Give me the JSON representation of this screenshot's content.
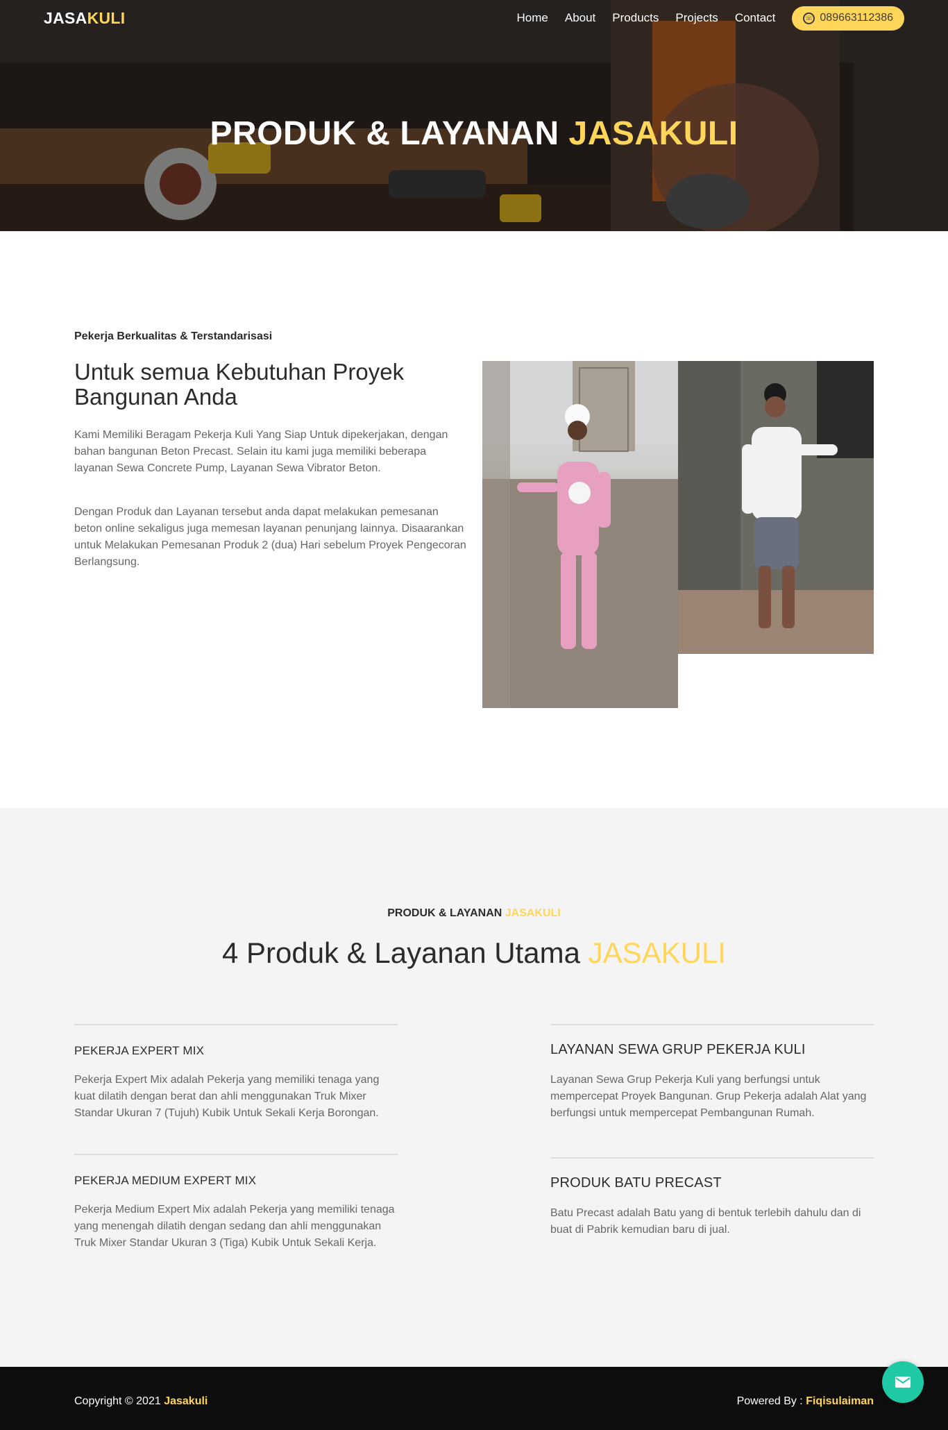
{
  "brand": {
    "part1": "JASA",
    "part2": "KULI"
  },
  "nav": {
    "items": [
      "Home",
      "About",
      "Products",
      "Projects",
      "Contact"
    ],
    "phone": "089663112386"
  },
  "hero": {
    "title_main": "PRODUK & LAYANAN",
    "title_accent": "JASAKULI"
  },
  "about": {
    "eyebrow": "Pekerja Berkualitas & Terstandarisasi",
    "heading": "Untuk semua Kebutuhan Proyek Bangunan Anda",
    "paragraph1": "Kami Memiliki Beragam Pekerja Kuli Yang Siap Untuk dipekerjakan, dengan bahan bangunan Beton Precast. Selain itu kami juga memiliki beberapa layanan Sewa Concrete Pump, Layanan Sewa Vibrator Beton.",
    "paragraph2": "Dengan Produk dan Layanan tersebut anda dapat melakukan pemesanan beton online sekaligus juga memesan layanan penunjang lainnya. Disaarankan untuk Melakukan Pemesanan Produk 2 (dua) Hari sebelum Proyek Pengecoran Berlangsung."
  },
  "services": {
    "eyebrow_main": "PRODUK & LAYANAN",
    "eyebrow_accent": "JASAKULI",
    "heading_main": "4 Produk & Layanan Utama",
    "heading_accent": "JASAKULI",
    "items": [
      {
        "title": "PEKERJA EXPERT MIX",
        "text": "Pekerja Expert Mix adalah Pekerja yang memiliki tenaga yang kuat dilatih dengan berat dan ahli menggunakan Truk Mixer Standar Ukuran 7 (Tujuh) Kubik Untuk Sekali Kerja Borongan."
      },
      {
        "title": "PEKERJA MEDIUM EXPERT MIX",
        "text": "Pekerja Medium Expert Mix adalah Pekerja yang memiliki tenaga yang menengah dilatih dengan sedang dan ahli menggunakan Truk Mixer Standar Ukuran 3 (Tiga) Kubik Untuk Sekali Kerja."
      },
      {
        "title": "LAYANAN SEWA GRUP PEKERJA KULI",
        "text": "Layanan Sewa Grup Pekerja Kuli yang berfungsi untuk mempercepat Proyek Bangunan. Grup Pekerja adalah Alat yang berfungsi untuk mempercepat Pembangunan Rumah."
      },
      {
        "title": "PRODUK BATU PRECAST",
        "text": "Batu Precast adalah Batu yang di bentuk terlebih dahulu dan di buat di Pabrik kemudian baru di jual."
      }
    ]
  },
  "footer": {
    "copyright": "Copyright © 2021",
    "copyright_name": "Jasakuli",
    "powered_by": "Powered By :",
    "powered_name": "Fiqisulaiman"
  },
  "colors": {
    "accent": "#ffd65a",
    "chat": "#1ec9a4",
    "footer_bg": "#0e0e0e",
    "section_bg": "#f4f4f4"
  }
}
